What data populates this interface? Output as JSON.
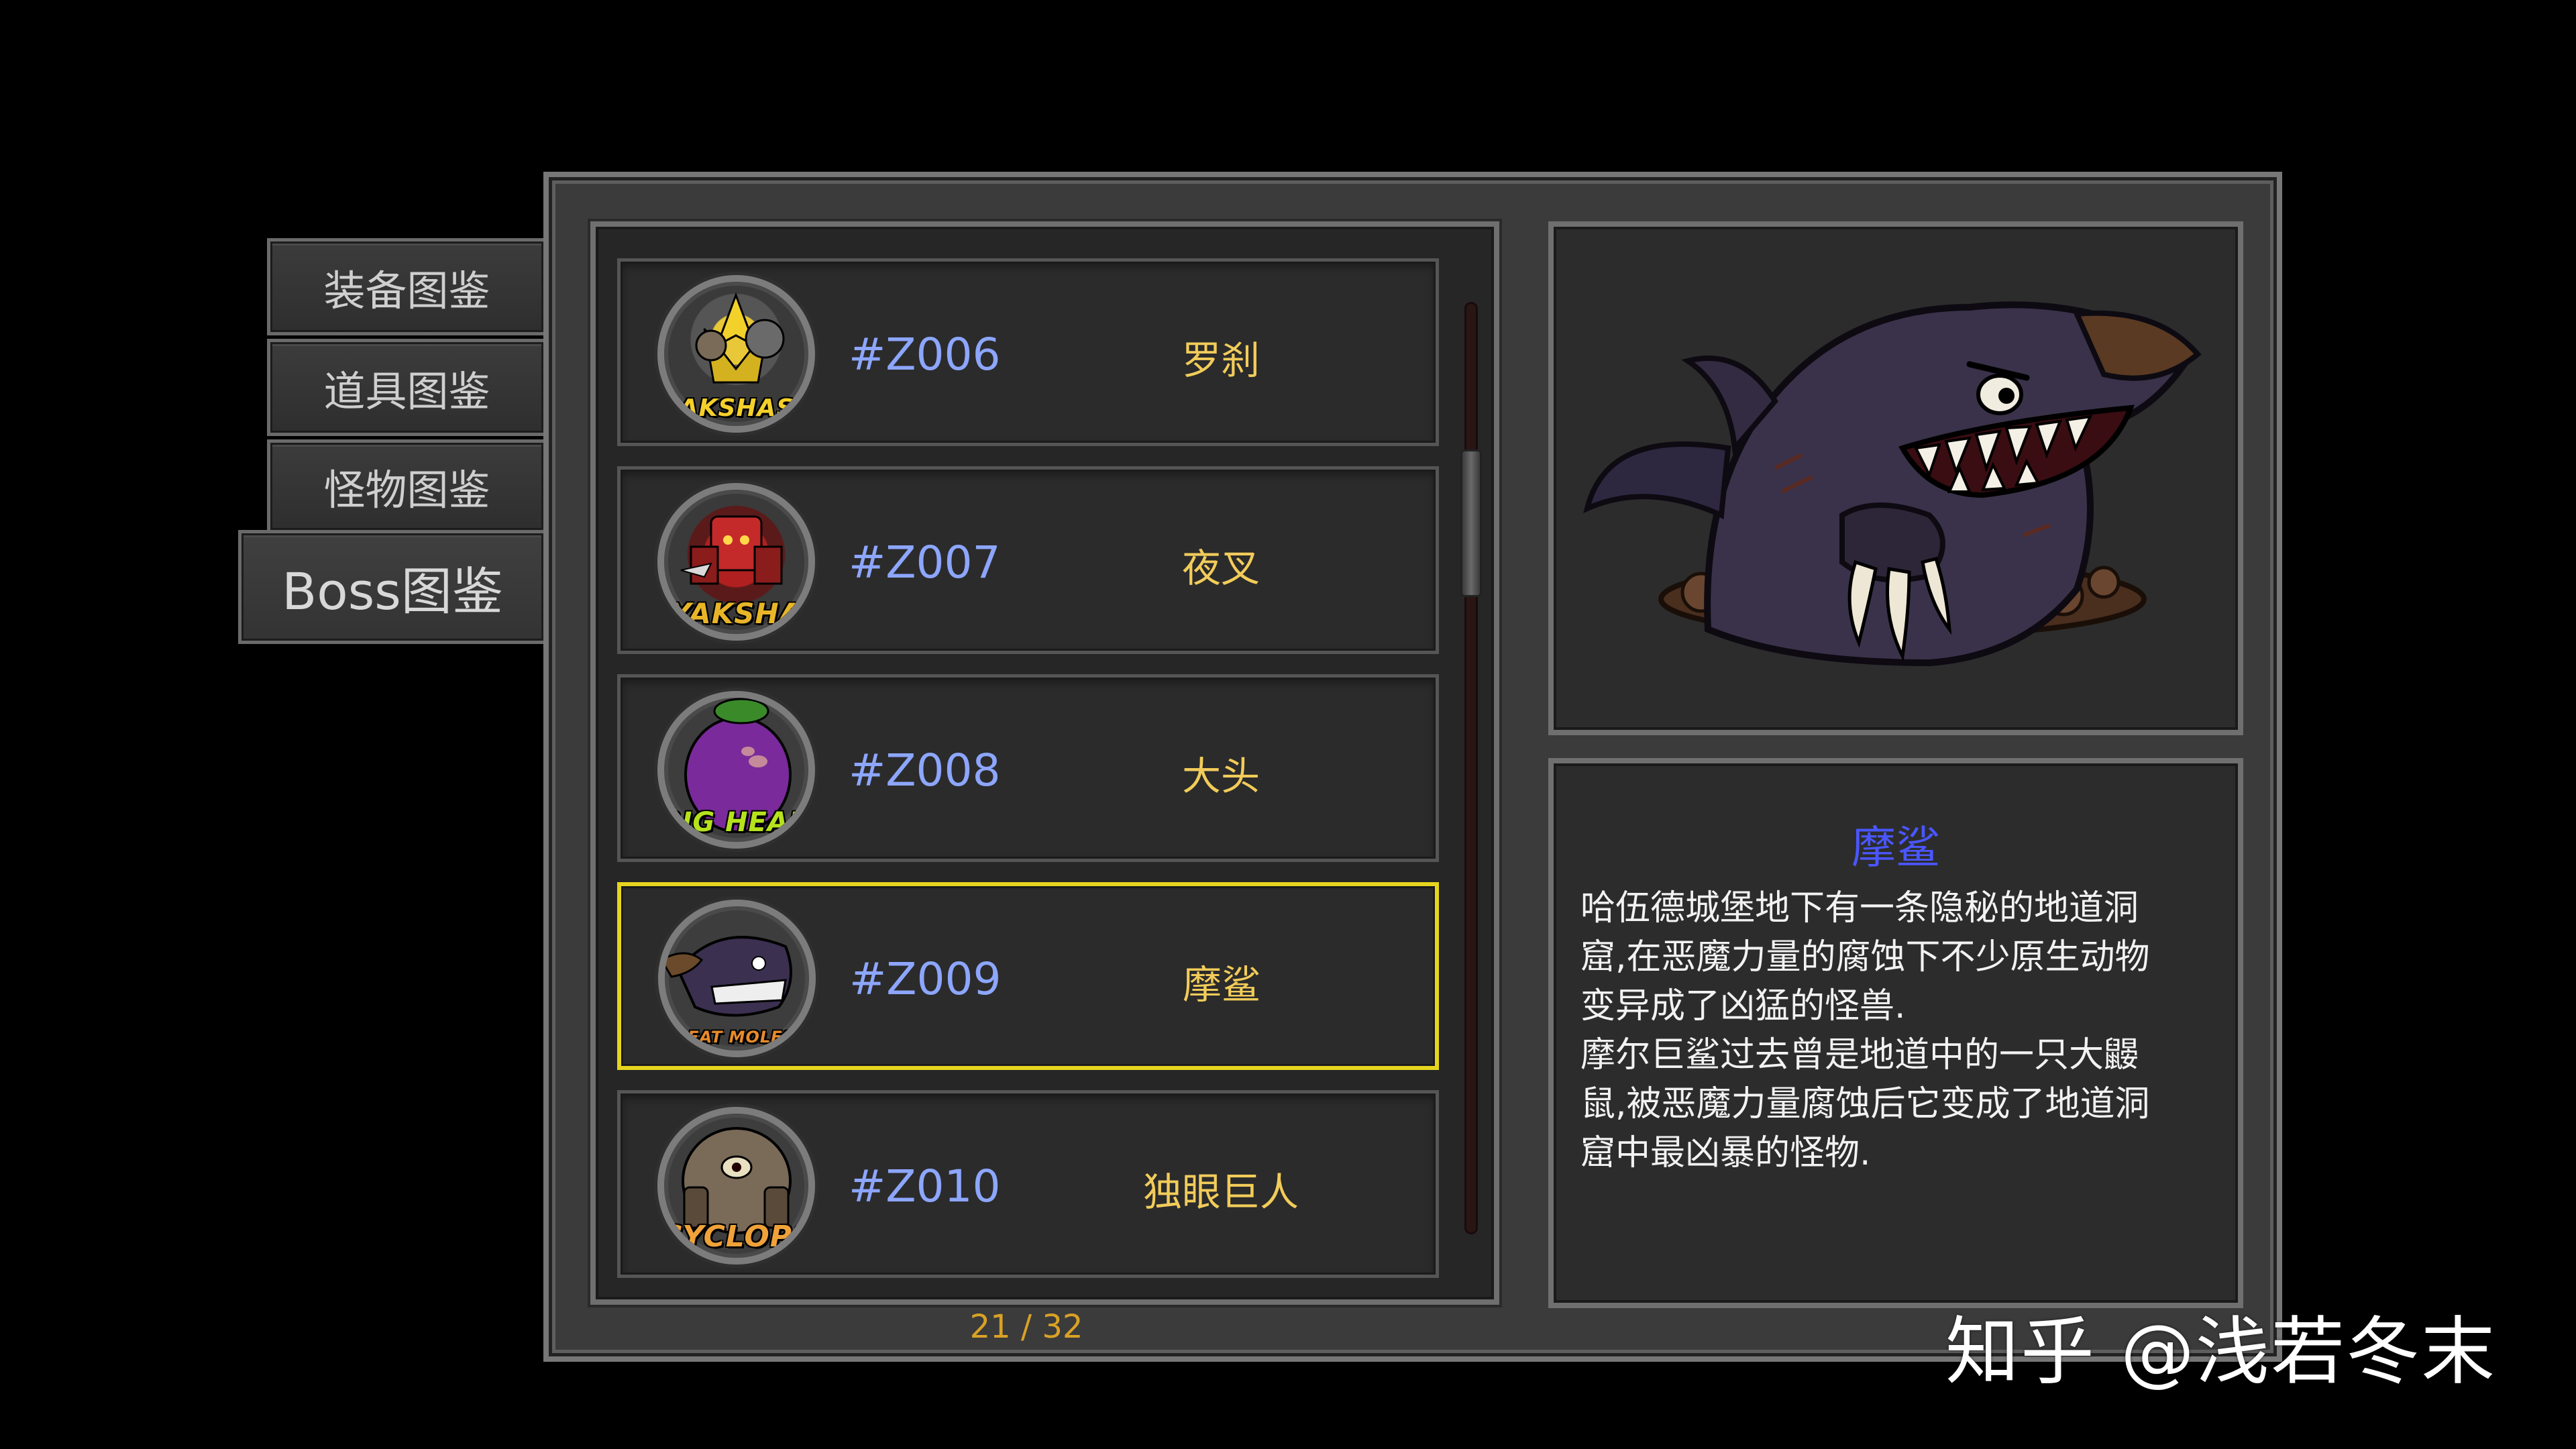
{
  "tabs": [
    {
      "label": "装备图鉴",
      "active": false
    },
    {
      "label": "道具图鉴",
      "active": false
    },
    {
      "label": "怪物图鉴",
      "active": false
    },
    {
      "label": "Boss图鉴",
      "active": true
    }
  ],
  "entries": [
    {
      "code": "#Z006",
      "name": "罗刹",
      "badge": "RAKSHASA",
      "badge_color": "#f5d02a"
    },
    {
      "code": "#Z007",
      "name": "夜叉",
      "badge": "YAKSHA",
      "badge_color": "#e8b528"
    },
    {
      "code": "#Z008",
      "name": "大头",
      "badge": "BIG HEAD",
      "badge_color": "#b6e21c"
    },
    {
      "code": "#Z009",
      "name": "摩鲨",
      "badge": "GREAT MOLESHARK",
      "badge_color": "#e98a2a"
    },
    {
      "code": "#Z010",
      "name": "独眼巨人",
      "badge": "CYCLOPS",
      "badge_color": "#f0a23a"
    }
  ],
  "selected_code": "#Z009",
  "pager": "21 / 32",
  "detail": {
    "title": "摩鲨",
    "body": "哈伍德城堡地下有一条隐秘的地道洞\n窟,在恶魔力量的腐蚀下不少原生动物\n变异成了凶猛的怪兽.\n摩尔巨鲨过去曾是地道中的一只大鼹\n鼠,被恶魔力量腐蚀后它变成了地道洞\n窟中最凶暴的怪物."
  },
  "watermark": "知乎 @浅若冬末",
  "colors": {
    "code_text": "#8da6ff",
    "name_text": "#f2cc5a",
    "selected_border": "#e6d51f",
    "detail_title": "#4a56ff",
    "pager_text": "#d9a225"
  }
}
